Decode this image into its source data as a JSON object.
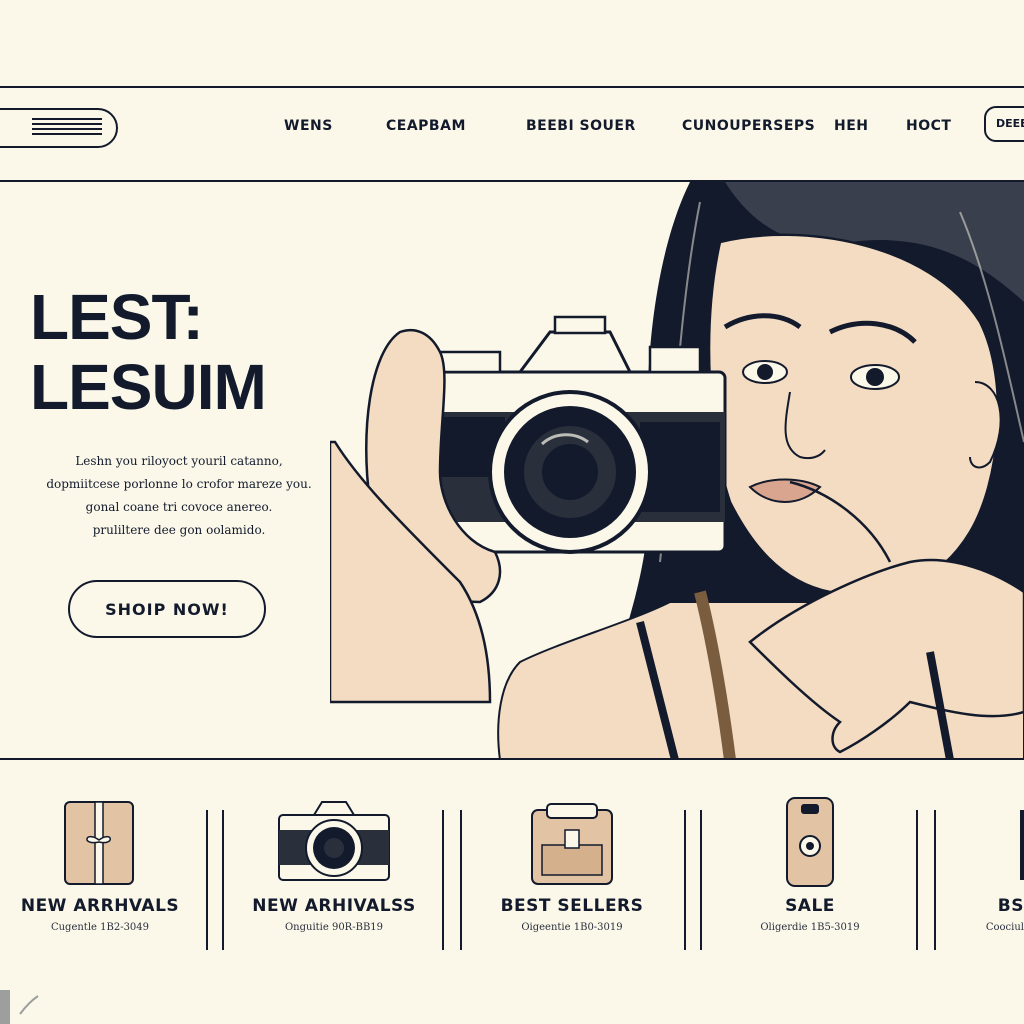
{
  "header": {
    "nav_items": [
      "WENS",
      "CEAPBAM",
      "BEEBI SOUER",
      "CUNOUPERSEPS",
      "HEH",
      "HOCT"
    ],
    "right_button": "DEEE"
  },
  "hero": {
    "title_line1": "LEST:",
    "title_line2": "LESUIM",
    "description": [
      "Leshn you riloyoct youril catanno,",
      "dopmiitcese porlonne lo crofor mareze you.",
      "gonal coane tri covoce anereo.",
      "pruliltere dee gon oolamido."
    ],
    "cta_label": "SHOIP NOW!"
  },
  "categories": [
    {
      "title": "NEW ARRHVALS",
      "subtitle": "Cugentle 1B2-3049"
    },
    {
      "title": "NEW ARHIVALSS",
      "subtitle": "Onguitie 90R-BB19"
    },
    {
      "title": "BEST SELLERS",
      "subtitle": "Oigeentie 1B0-3019"
    },
    {
      "title": "SALE",
      "subtitle": "Oligerdie 1B5-3019"
    },
    {
      "title": "BS",
      "subtitle": "Coociul"
    }
  ],
  "colors": {
    "background": "#fbf8ea",
    "ink": "#121a2c",
    "skin": "#f4dcc2",
    "accent_tan": "#e2c4a4"
  }
}
